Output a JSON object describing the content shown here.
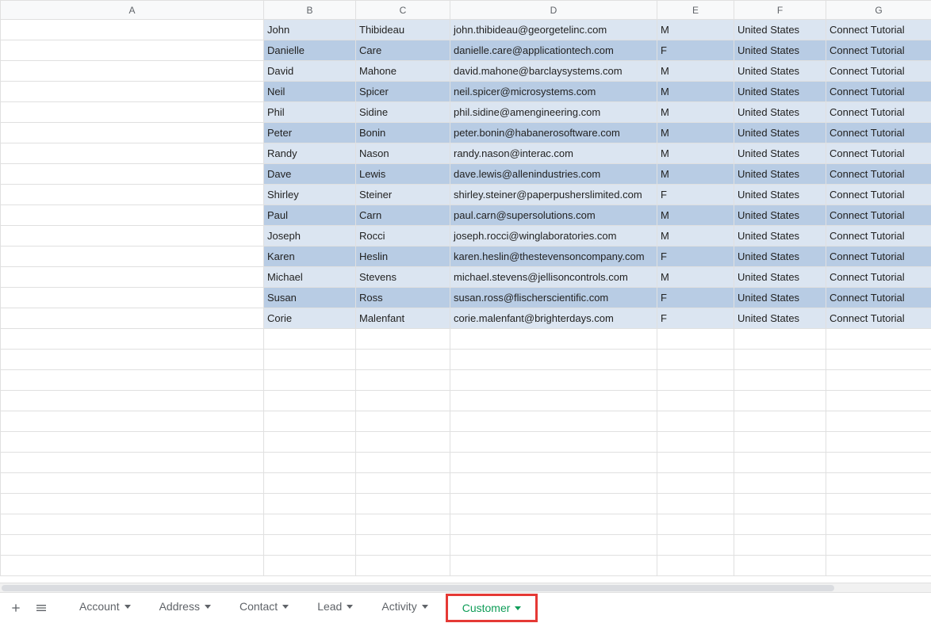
{
  "columns": [
    "A",
    "B",
    "C",
    "D",
    "E",
    "F",
    "G"
  ],
  "rows": [
    {
      "a": "",
      "b": "John",
      "c": "Thibideau",
      "d": "john.thibideau@georgetelinc.com",
      "e": "M",
      "f": "United States",
      "g": "Connect Tutorial"
    },
    {
      "a": "",
      "b": "Danielle",
      "c": "Care",
      "d": "danielle.care@applicationtech.com",
      "e": "F",
      "f": "United States",
      "g": "Connect Tutorial"
    },
    {
      "a": "",
      "b": "David",
      "c": "Mahone",
      "d": "david.mahone@barclaysystems.com",
      "e": "M",
      "f": "United States",
      "g": "Connect Tutorial"
    },
    {
      "a": "",
      "b": "Neil",
      "c": "Spicer",
      "d": "neil.spicer@microsystems.com",
      "e": "M",
      "f": "United States",
      "g": "Connect Tutorial"
    },
    {
      "a": "",
      "b": "Phil",
      "c": "Sidine",
      "d": "phil.sidine@amengineering.com",
      "e": "M",
      "f": "United States",
      "g": "Connect Tutorial"
    },
    {
      "a": "",
      "b": "Peter",
      "c": "Bonin",
      "d": "peter.bonin@habanerosoftware.com",
      "e": "M",
      "f": "United States",
      "g": "Connect Tutorial"
    },
    {
      "a": "",
      "b": "Randy",
      "c": "Nason",
      "d": "randy.nason@interac.com",
      "e": "M",
      "f": "United States",
      "g": "Connect Tutorial"
    },
    {
      "a": "",
      "b": "Dave",
      "c": "Lewis",
      "d": "dave.lewis@allenindustries.com",
      "e": "M",
      "f": "United States",
      "g": "Connect Tutorial"
    },
    {
      "a": "",
      "b": "Shirley",
      "c": "Steiner",
      "d": "shirley.steiner@paperpusherslimited.com",
      "e": "F",
      "f": "United States",
      "g": "Connect Tutorial"
    },
    {
      "a": "",
      "b": "Paul",
      "c": "Carn",
      "d": "paul.carn@supersolutions.com",
      "e": "M",
      "f": "United States",
      "g": "Connect Tutorial"
    },
    {
      "a": "",
      "b": "Joseph",
      "c": "Rocci",
      "d": "joseph.rocci@winglaboratories.com",
      "e": "M",
      "f": "United States",
      "g": "Connect Tutorial"
    },
    {
      "a": "",
      "b": "Karen",
      "c": "Heslin",
      "d": "karen.heslin@thestevensoncompany.com",
      "e": "F",
      "f": "United States",
      "g": "Connect Tutorial"
    },
    {
      "a": "",
      "b": "Michael",
      "c": "Stevens",
      "d": "michael.stevens@jellisoncontrols.com",
      "e": "M",
      "f": "United States",
      "g": "Connect Tutorial"
    },
    {
      "a": "",
      "b": "Susan",
      "c": "Ross",
      "d": "susan.ross@flischerscientific.com",
      "e": "F",
      "f": "United States",
      "g": "Connect Tutorial"
    },
    {
      "a": "",
      "b": "Corie",
      "c": "Malenfant",
      "d": "corie.malenfant@brighterdays.com",
      "e": "F",
      "f": "United States",
      "g": "Connect Tutorial"
    }
  ],
  "empty_row_count": 12,
  "tabs": [
    {
      "label": "Account",
      "active": false
    },
    {
      "label": "Address",
      "active": false
    },
    {
      "label": "Contact",
      "active": false
    },
    {
      "label": "Lead",
      "active": false
    },
    {
      "label": "Activity",
      "active": false
    },
    {
      "label": "Customer",
      "active": true
    }
  ]
}
